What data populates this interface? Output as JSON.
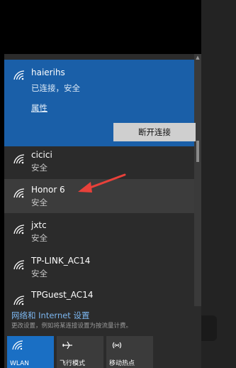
{
  "networks": [
    {
      "name": "haierihs",
      "status": "已连接，安全",
      "properties_link": "属性",
      "action_button": "断开连接"
    },
    {
      "name": "cicici",
      "status": "安全"
    },
    {
      "name": "Honor 6",
      "status": "安全"
    },
    {
      "name": "jxtc",
      "status": "安全"
    },
    {
      "name": "TP-LINK_AC14",
      "status": "安全"
    },
    {
      "name": "TPGuest_AC14",
      "status": "安全"
    }
  ],
  "footer": {
    "settings_link": "网络和 Internet 设置",
    "settings_desc": "更改设置，例如将某连接设置为按流量计费。"
  },
  "quick_actions": [
    {
      "label": "WLAN",
      "icon": "wifi-icon",
      "active": true
    },
    {
      "label": "飞行模式",
      "icon": "airplane-icon",
      "active": false
    },
    {
      "label": "移动热点",
      "icon": "hotspot-icon",
      "active": false
    }
  ],
  "colors": {
    "accent": "#1a5fa8",
    "annotation_arrow": "#e8413a"
  }
}
